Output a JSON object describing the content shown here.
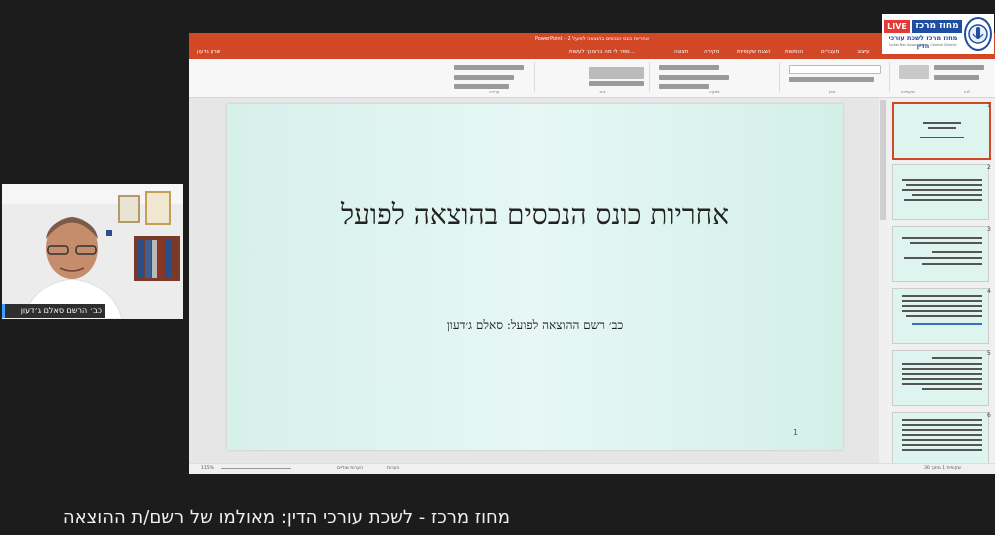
{
  "powerpoint": {
    "title_bar": "PowerPoint - אחריות כונס הנכסים בהוצאה לפועל 2",
    "signin": "שרון גדעון",
    "tabs": [
      "קובץ",
      "בית",
      "הוספה",
      "עיצוב",
      "מעברים",
      "הנפשות",
      "הצגת שקופיות",
      "סקירה",
      "תצוגה",
      "ספר לי מה ברצונך לעשות..."
    ],
    "groups": [
      "לוח",
      "שקופיות",
      "גופן",
      "פסקה",
      "ציור",
      "עריכה"
    ],
    "slide": {
      "title": "אחריות כונס הנכסים בהוצאה לפועל",
      "subtitle": "כב׳ רשם ההוצאה לפועל: סאלם ג׳דעון",
      "number": "1"
    },
    "thumbnails": [
      "1",
      "2",
      "3",
      "4",
      "5",
      "6"
    ],
    "status": {
      "slide_of": "שקופית 1 מתוך 30",
      "notes": "הערות",
      "comments": "הערות שוליים",
      "zoom": "115%"
    }
  },
  "webcam": {
    "name": "כב׳ הרשם סאלם ג׳דעון"
  },
  "logo": {
    "live": "LIVE",
    "district": "מחוז מרכז",
    "bar": "מחוז מרכז לשכת עורכי הדין",
    "english": "Israel Bar Association · Central District"
  },
  "caption": "מחוז מרכז - לשכת עורכי הדין: מאולמו של רשם/ת ההוצאה"
}
